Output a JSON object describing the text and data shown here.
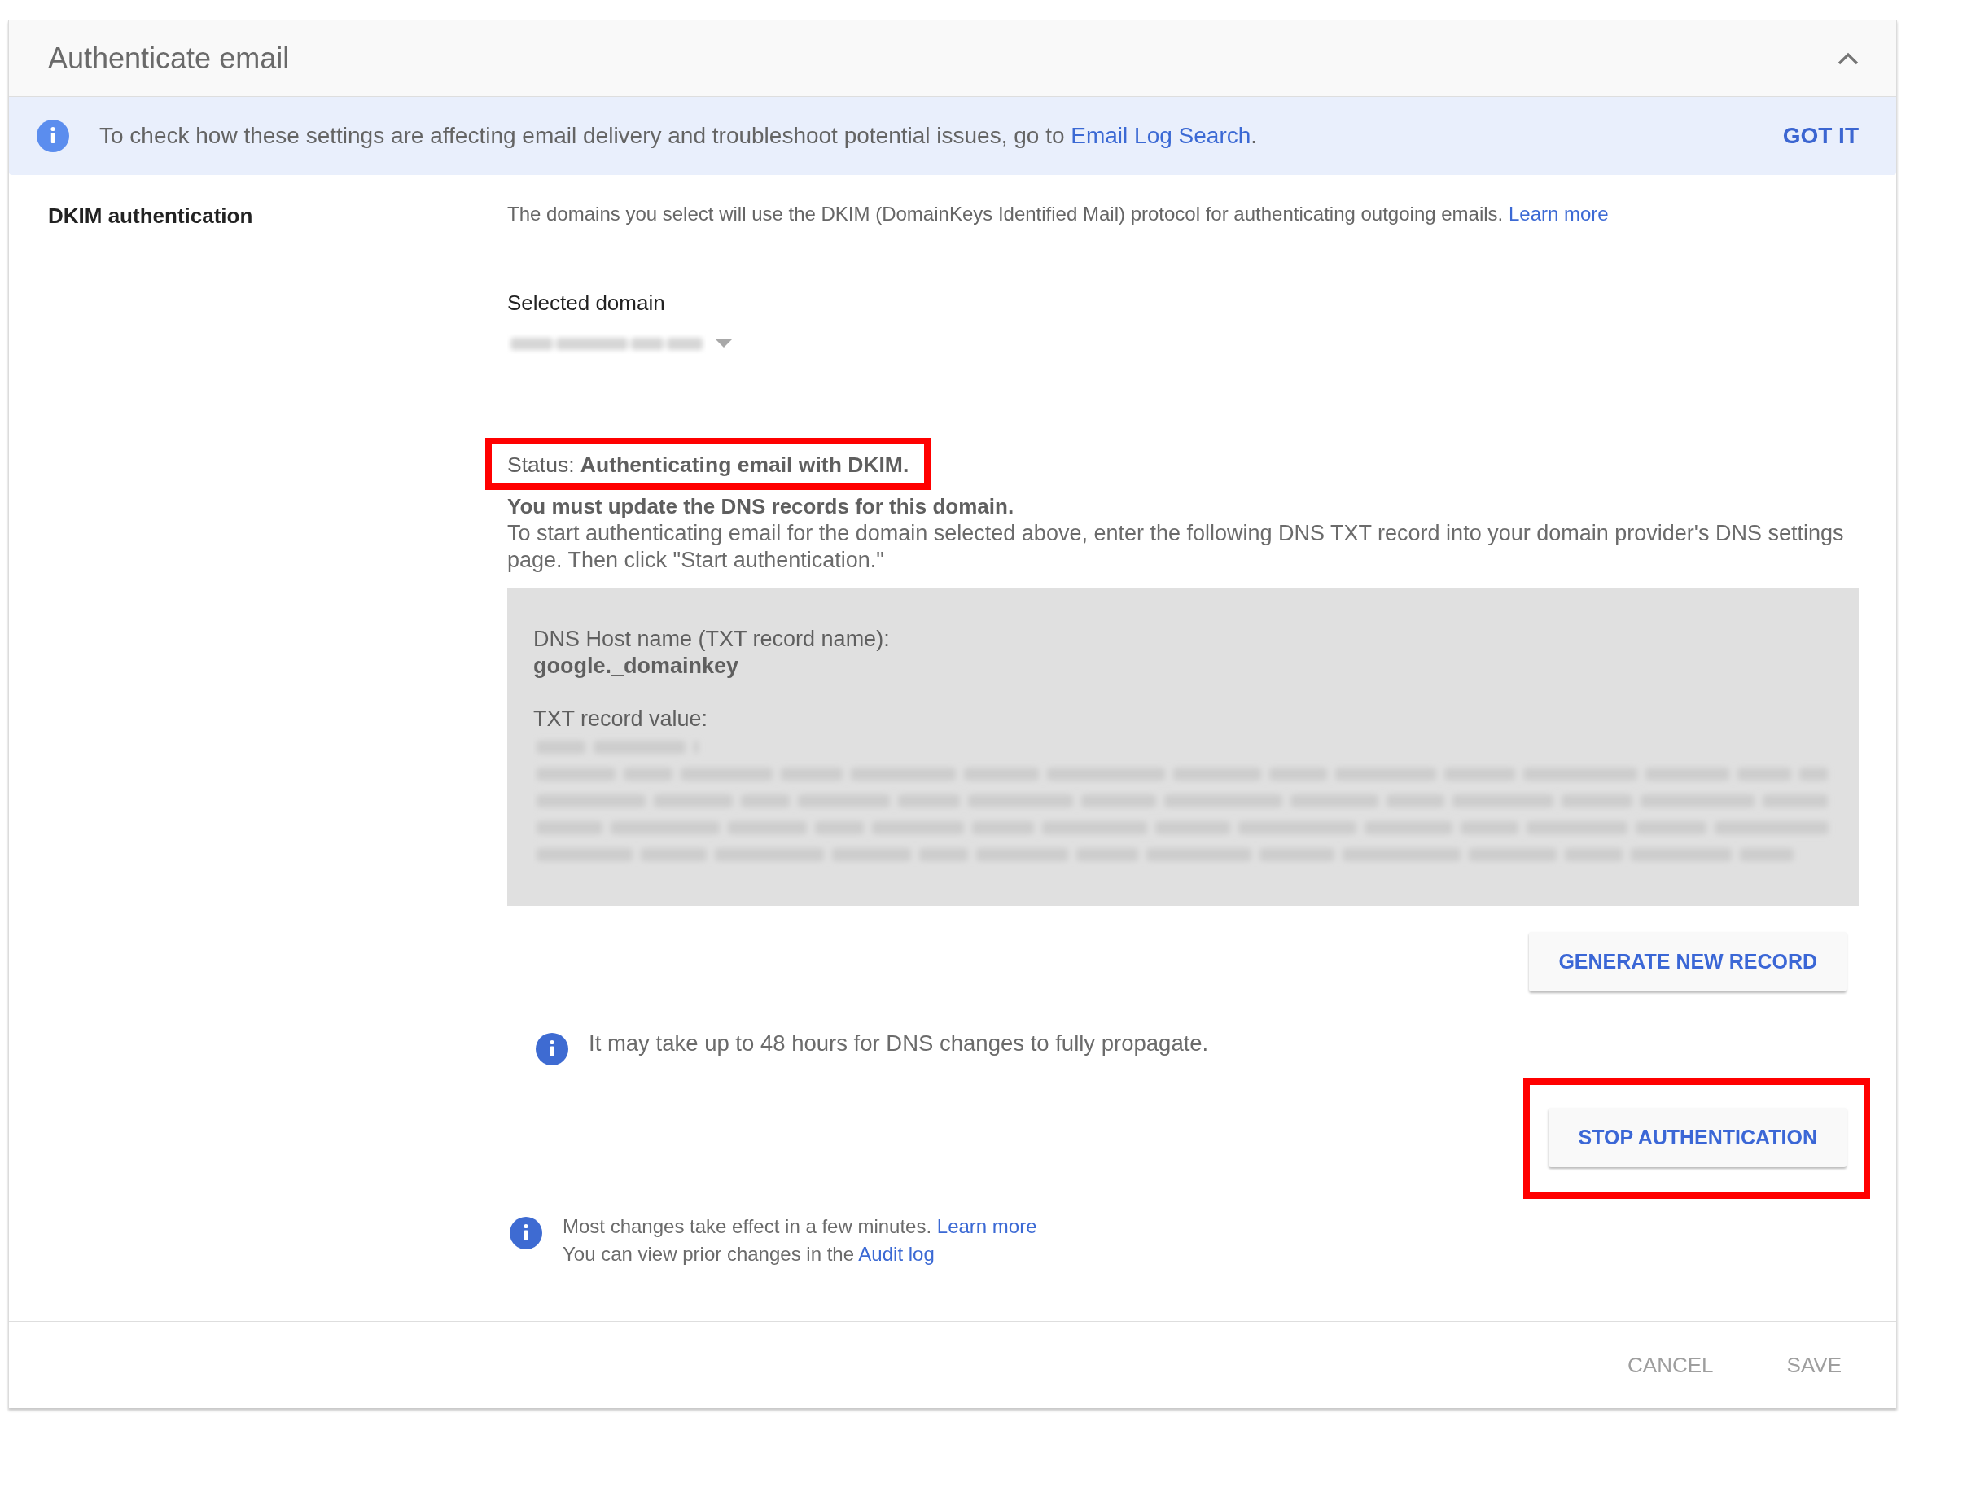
{
  "panel": {
    "title": "Authenticate email",
    "expanded": true
  },
  "banner": {
    "text": "To check how these settings are affecting email delivery and troubleshoot potential issues, go to",
    "link": "Email Log Search",
    "after_link": ".",
    "button": "GOT IT"
  },
  "dkim": {
    "label": "DKIM authentication",
    "description": {
      "text": "The domains you select will use the DKIM (DomainKeys Identified Mail) protocol for authenticating outgoing emails.",
      "link": "Learn more"
    },
    "domain_select": {
      "label": "Selected domain"
    },
    "status": {
      "text": "Status: **Authenticating email with DKIM.**",
      "highlighted": true
    },
    "notice": {
      "title": "You must update the DNS records for this domain.",
      "text": "To start authenticating email for the domain selected above, enter the following DNS TXT record into your domain provider's DNS settings page. Then click \"Start authentication.\""
    },
    "record": {
      "host_label": "DNS Host name (TXT record name):",
      "host_value": "google._domainkey",
      "value_label": "TXT record value:"
    },
    "generate_button": {
      "label": "GENERATE NEW RECORD"
    },
    "propagation_note": "It may take up to 48 hours for DNS changes to fully propagate.",
    "stop_button": {
      "label": "STOP AUTHENTICATION",
      "highlighted": true
    },
    "notes": [
      {
        "text": "Most changes take effect in a few minutes.",
        "link": "Learn more"
      },
      {
        "text": "You can view prior changes in the",
        "link": "Audit log"
      }
    ]
  },
  "footer": {
    "buttons": [
      {
        "label": "CANCEL",
        "disabled": true
      },
      {
        "label": "SAVE",
        "disabled": true
      }
    ]
  }
}
